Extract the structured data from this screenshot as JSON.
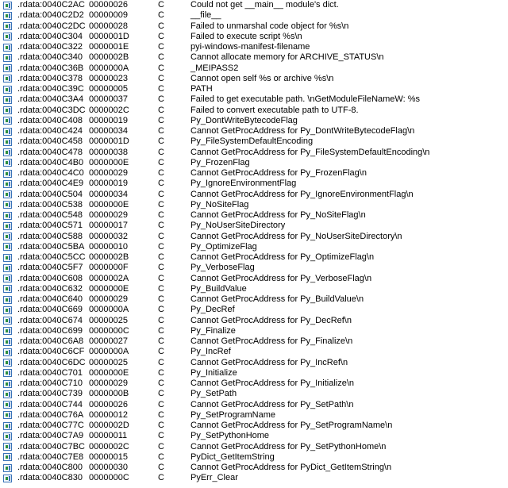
{
  "strings_window": {
    "rows": [
      {
        "icon": "string-icon",
        "address": ".rdata:0040C2AC",
        "length": "00000026",
        "type": "C",
        "string": "Could not get __main__ module's dict."
      },
      {
        "icon": "string-icon",
        "address": ".rdata:0040C2D2",
        "length": "00000009",
        "type": "C",
        "string": "__file__"
      },
      {
        "icon": "string-icon",
        "address": ".rdata:0040C2DC",
        "length": "00000028",
        "type": "C",
        "string": "Failed to unmarshal code object for %s\\n"
      },
      {
        "icon": "string-icon",
        "address": ".rdata:0040C304",
        "length": "0000001D",
        "type": "C",
        "string": "Failed to execute script %s\\n"
      },
      {
        "icon": "string-icon",
        "address": ".rdata:0040C322",
        "length": "0000001E",
        "type": "C",
        "string": "pyi-windows-manifest-filename"
      },
      {
        "icon": "string-icon",
        "address": ".rdata:0040C340",
        "length": "0000002B",
        "type": "C",
        "string": "Cannot allocate memory for ARCHIVE_STATUS\\n"
      },
      {
        "icon": "string-icon",
        "address": ".rdata:0040C36B",
        "length": "0000000A",
        "type": "C",
        "string": "_MEIPASS2"
      },
      {
        "icon": "string-icon",
        "address": ".rdata:0040C378",
        "length": "00000023",
        "type": "C",
        "string": "Cannot open self %s or archive %s\\n"
      },
      {
        "icon": "string-icon",
        "address": ".rdata:0040C39C",
        "length": "00000005",
        "type": "C",
        "string": "PATH"
      },
      {
        "icon": "string-icon",
        "address": ".rdata:0040C3A4",
        "length": "00000037",
        "type": "C",
        "string": "Failed to get executable path. \\nGetModuleFileNameW: %s"
      },
      {
        "icon": "string-icon",
        "address": ".rdata:0040C3DC",
        "length": "0000002C",
        "type": "C",
        "string": "Failed to convert executable path to UTF-8."
      },
      {
        "icon": "string-icon",
        "address": ".rdata:0040C408",
        "length": "00000019",
        "type": "C",
        "string": "Py_DontWriteBytecodeFlag"
      },
      {
        "icon": "string-icon",
        "address": ".rdata:0040C424",
        "length": "00000034",
        "type": "C",
        "string": "Cannot GetProcAddress for Py_DontWriteBytecodeFlag\\n"
      },
      {
        "icon": "string-icon",
        "address": ".rdata:0040C458",
        "length": "0000001D",
        "type": "C",
        "string": "Py_FileSystemDefaultEncoding"
      },
      {
        "icon": "string-icon",
        "address": ".rdata:0040C478",
        "length": "00000038",
        "type": "C",
        "string": "Cannot GetProcAddress for Py_FileSystemDefaultEncoding\\n"
      },
      {
        "icon": "string-icon",
        "address": ".rdata:0040C4B0",
        "length": "0000000E",
        "type": "C",
        "string": "Py_FrozenFlag"
      },
      {
        "icon": "string-icon",
        "address": ".rdata:0040C4C0",
        "length": "00000029",
        "type": "C",
        "string": "Cannot GetProcAddress for Py_FrozenFlag\\n"
      },
      {
        "icon": "string-icon",
        "address": ".rdata:0040C4E9",
        "length": "00000019",
        "type": "C",
        "string": "Py_IgnoreEnvironmentFlag"
      },
      {
        "icon": "string-icon",
        "address": ".rdata:0040C504",
        "length": "00000034",
        "type": "C",
        "string": "Cannot GetProcAddress for Py_IgnoreEnvironmentFlag\\n"
      },
      {
        "icon": "string-icon",
        "address": ".rdata:0040C538",
        "length": "0000000E",
        "type": "C",
        "string": "Py_NoSiteFlag"
      },
      {
        "icon": "string-icon",
        "address": ".rdata:0040C548",
        "length": "00000029",
        "type": "C",
        "string": "Cannot GetProcAddress for Py_NoSiteFlag\\n"
      },
      {
        "icon": "string-icon",
        "address": ".rdata:0040C571",
        "length": "00000017",
        "type": "C",
        "string": "Py_NoUserSiteDirectory"
      },
      {
        "icon": "string-icon",
        "address": ".rdata:0040C588",
        "length": "00000032",
        "type": "C",
        "string": "Cannot GetProcAddress for Py_NoUserSiteDirectory\\n"
      },
      {
        "icon": "string-icon",
        "address": ".rdata:0040C5BA",
        "length": "00000010",
        "type": "C",
        "string": "Py_OptimizeFlag"
      },
      {
        "icon": "string-icon",
        "address": ".rdata:0040C5CC",
        "length": "0000002B",
        "type": "C",
        "string": "Cannot GetProcAddress for Py_OptimizeFlag\\n"
      },
      {
        "icon": "string-icon",
        "address": ".rdata:0040C5F7",
        "length": "0000000F",
        "type": "C",
        "string": "Py_VerboseFlag"
      },
      {
        "icon": "string-icon",
        "address": ".rdata:0040C608",
        "length": "0000002A",
        "type": "C",
        "string": "Cannot GetProcAddress for Py_VerboseFlag\\n"
      },
      {
        "icon": "string-icon",
        "address": ".rdata:0040C632",
        "length": "0000000E",
        "type": "C",
        "string": "Py_BuildValue"
      },
      {
        "icon": "string-icon",
        "address": ".rdata:0040C640",
        "length": "00000029",
        "type": "C",
        "string": "Cannot GetProcAddress for Py_BuildValue\\n"
      },
      {
        "icon": "string-icon",
        "address": ".rdata:0040C669",
        "length": "0000000A",
        "type": "C",
        "string": "Py_DecRef"
      },
      {
        "icon": "string-icon",
        "address": ".rdata:0040C674",
        "length": "00000025",
        "type": "C",
        "string": "Cannot GetProcAddress for Py_DecRef\\n"
      },
      {
        "icon": "string-icon",
        "address": ".rdata:0040C699",
        "length": "0000000C",
        "type": "C",
        "string": "Py_Finalize"
      },
      {
        "icon": "string-icon",
        "address": ".rdata:0040C6A8",
        "length": "00000027",
        "type": "C",
        "string": "Cannot GetProcAddress for Py_Finalize\\n"
      },
      {
        "icon": "string-icon",
        "address": ".rdata:0040C6CF",
        "length": "0000000A",
        "type": "C",
        "string": "Py_IncRef"
      },
      {
        "icon": "string-icon",
        "address": ".rdata:0040C6DC",
        "length": "00000025",
        "type": "C",
        "string": "Cannot GetProcAddress for Py_IncRef\\n"
      },
      {
        "icon": "string-icon",
        "address": ".rdata:0040C701",
        "length": "0000000E",
        "type": "C",
        "string": "Py_Initialize"
      },
      {
        "icon": "string-icon",
        "address": ".rdata:0040C710",
        "length": "00000029",
        "type": "C",
        "string": "Cannot GetProcAddress for Py_Initialize\\n"
      },
      {
        "icon": "string-icon",
        "address": ".rdata:0040C739",
        "length": "0000000B",
        "type": "C",
        "string": "Py_SetPath"
      },
      {
        "icon": "string-icon",
        "address": ".rdata:0040C744",
        "length": "00000026",
        "type": "C",
        "string": "Cannot GetProcAddress for Py_SetPath\\n"
      },
      {
        "icon": "string-icon",
        "address": ".rdata:0040C76A",
        "length": "00000012",
        "type": "C",
        "string": "Py_SetProgramName"
      },
      {
        "icon": "string-icon",
        "address": ".rdata:0040C77C",
        "length": "0000002D",
        "type": "C",
        "string": "Cannot GetProcAddress for Py_SetProgramName\\n"
      },
      {
        "icon": "string-icon",
        "address": ".rdata:0040C7A9",
        "length": "00000011",
        "type": "C",
        "string": "Py_SetPythonHome"
      },
      {
        "icon": "string-icon",
        "address": ".rdata:0040C7BC",
        "length": "0000002C",
        "type": "C",
        "string": "Cannot GetProcAddress for Py_SetPythonHome\\n"
      },
      {
        "icon": "string-icon",
        "address": ".rdata:0040C7E8",
        "length": "00000015",
        "type": "C",
        "string": "PyDict_GetItemString"
      },
      {
        "icon": "string-icon",
        "address": ".rdata:0040C800",
        "length": "00000030",
        "type": "C",
        "string": "Cannot GetProcAddress for PyDict_GetItemString\\n"
      },
      {
        "icon": "string-icon",
        "address": ".rdata:0040C830",
        "length": "0000000C",
        "type": "C",
        "string": "PyErr_Clear"
      }
    ]
  }
}
